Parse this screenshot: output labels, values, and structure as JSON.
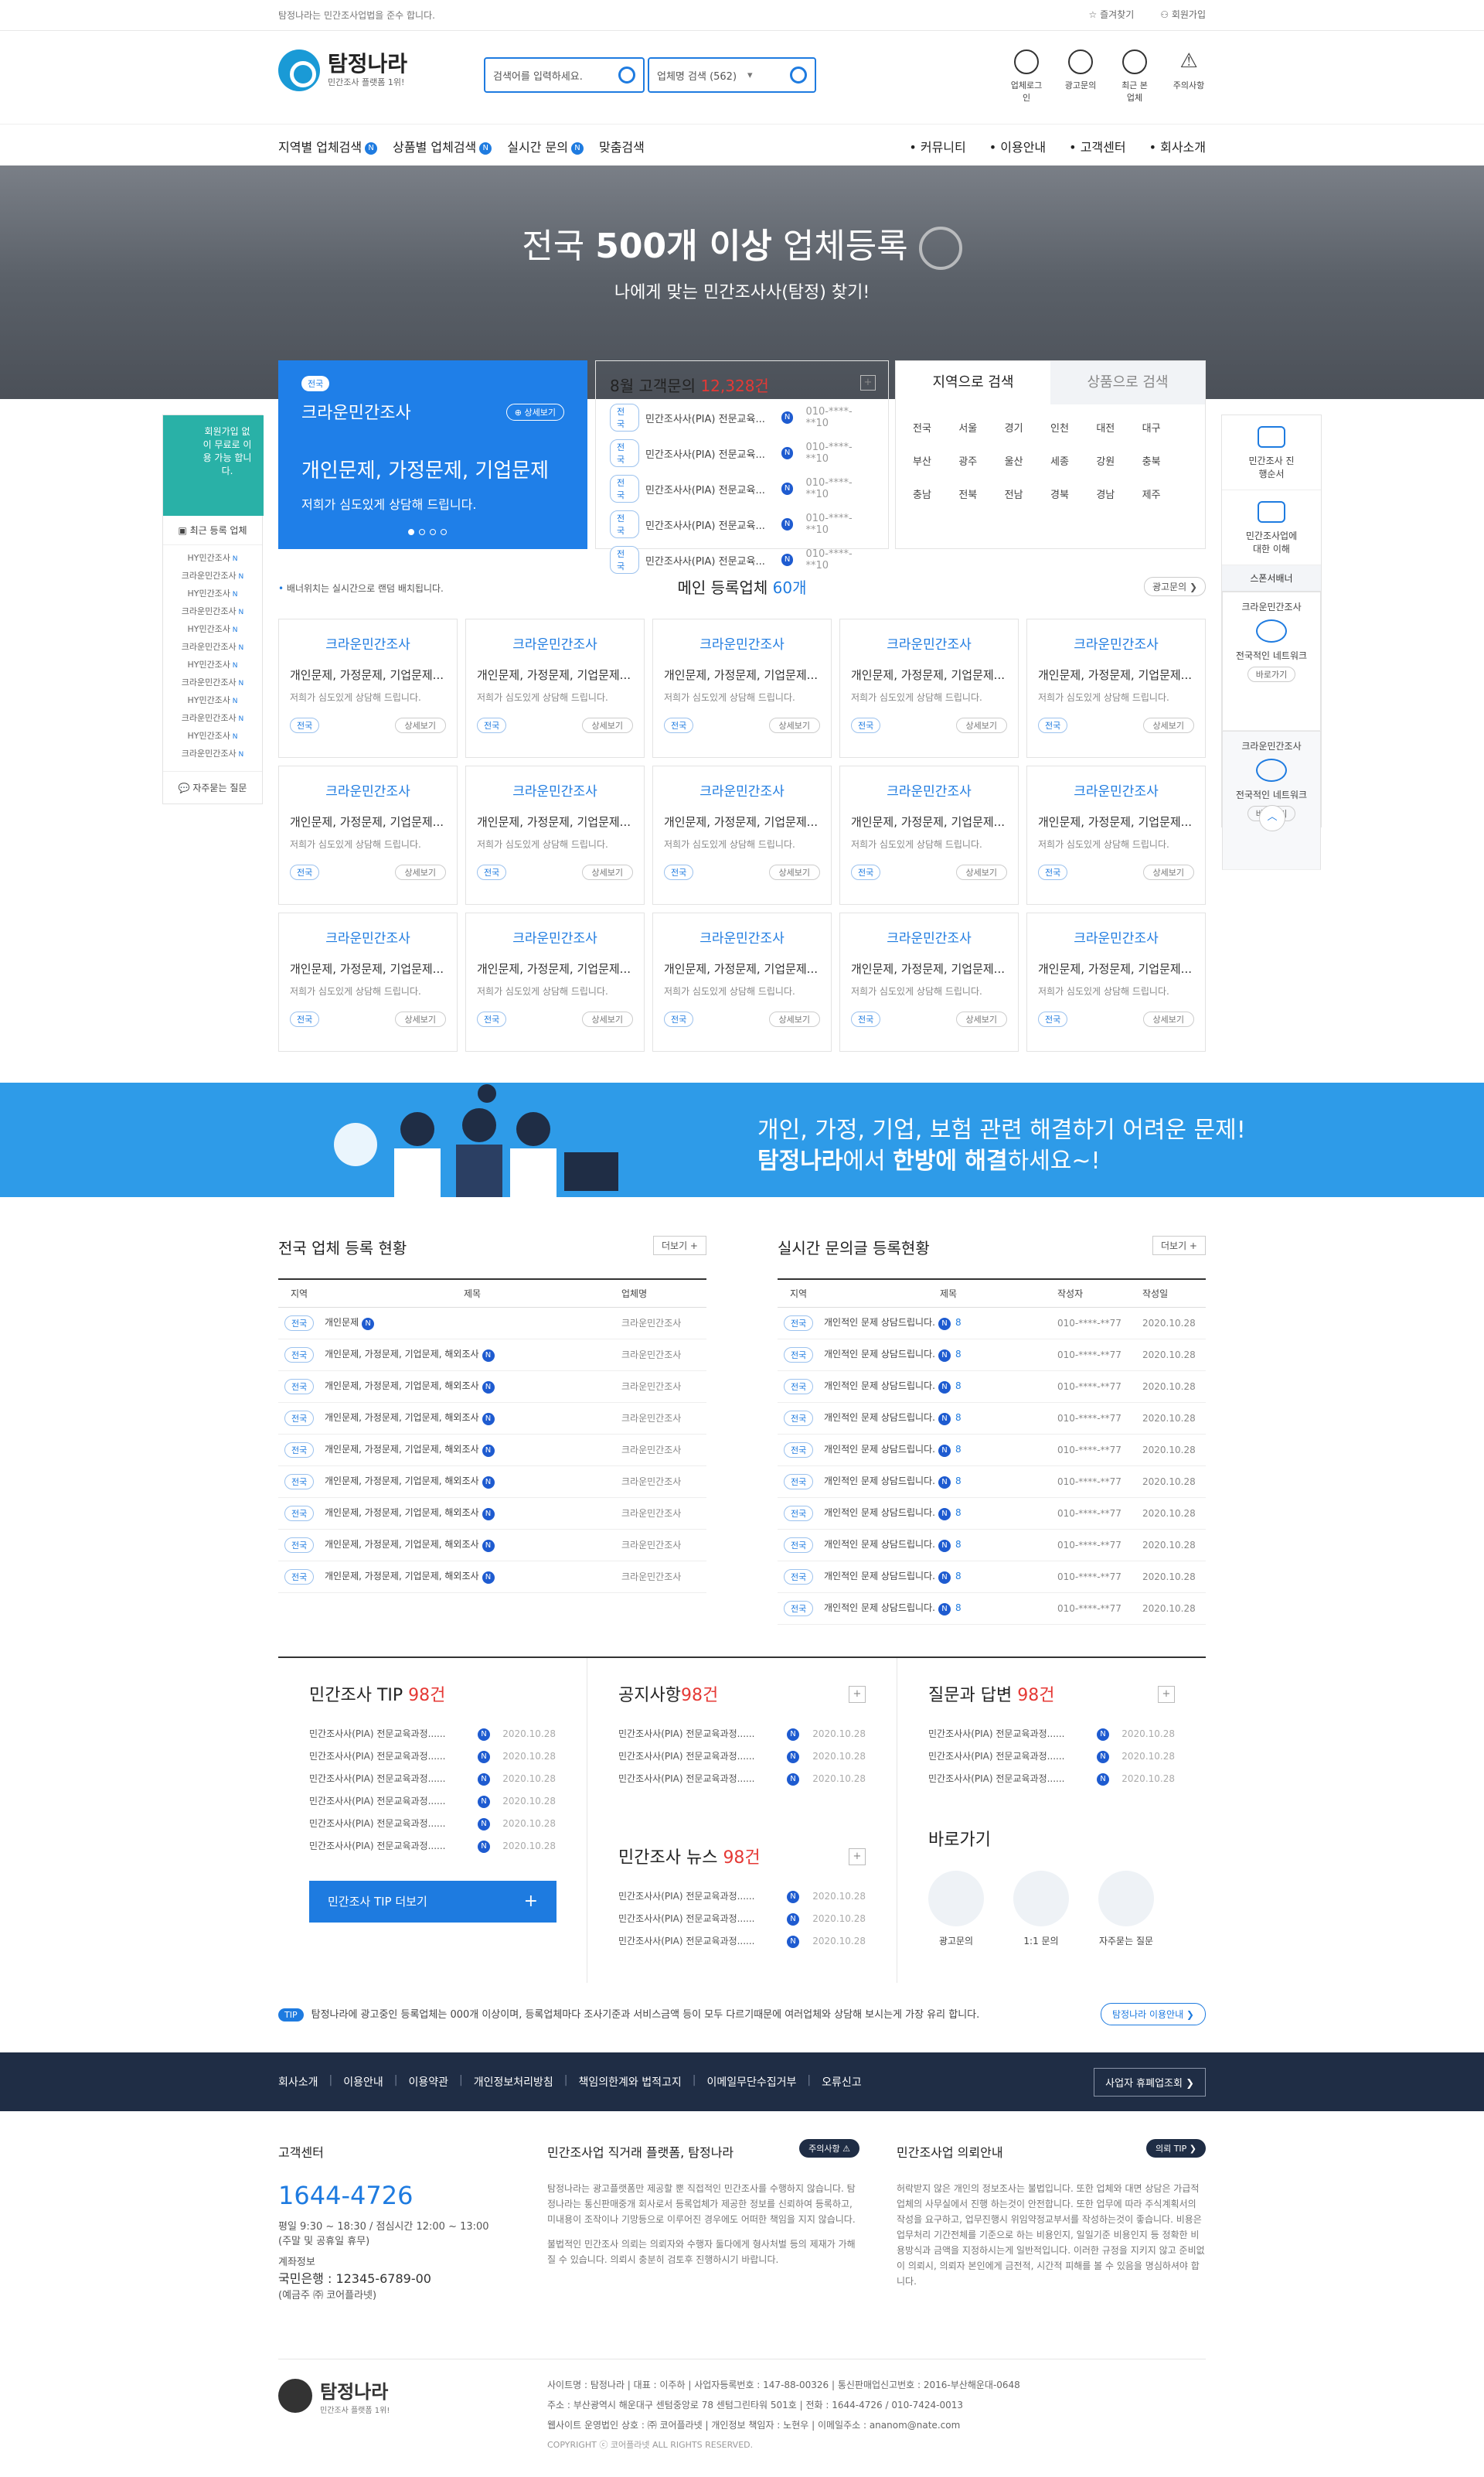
{
  "topbar": {
    "notice": "탐정나라는 민간조사업법을 준수 합니다.",
    "bookmark": "즐겨찾기",
    "join": "회원가입"
  },
  "header": {
    "logo": "탐정나라",
    "logo_sub": "민간조사 플랫폼 1위!",
    "search_placeholder": "검색어를 입력하세요.",
    "company_search": "업체명 검색 (562)",
    "icons": [
      {
        "label": "업체로그인",
        "icon": "user-icon"
      },
      {
        "label": "광고문의",
        "icon": "key-icon"
      },
      {
        "label": "최근 본 업체",
        "icon": "eye-icon"
      },
      {
        "label": "주의사항",
        "icon": "warning-icon"
      }
    ]
  },
  "nav": {
    "left": [
      "지역별 업체검색",
      "상품별 업체검색",
      "실시간 문의",
      "맞춤검색"
    ],
    "right": [
      "커뮤니티",
      "이용안내",
      "고객센터",
      "회사소개"
    ]
  },
  "hero": {
    "title_pre": "전국 ",
    "title_bold": "500개 이상",
    "title_post": " 업체등록",
    "subtitle": "나에게 맞는 민간조사사(탐정) 찾기!"
  },
  "promo": {
    "tag": "전국",
    "name": "크라운민간조사",
    "more": "상세보기",
    "headline": "개인문제, 가정문제, 기업문제",
    "sub": "저희가 심도있게 상담해 드립니다."
  },
  "inquiry": {
    "title": "8월 고객문의",
    "count": "12,328건",
    "plus": "+",
    "rows": [
      {
        "tag": "전국",
        "text": "민간조사사(PIA) 전문교육...",
        "phone": "010-****-**10"
      },
      {
        "tag": "전국",
        "text": "민간조사사(PIA) 전문교육...",
        "phone": "010-****-**10"
      },
      {
        "tag": "전국",
        "text": "민간조사사(PIA) 전문교육...",
        "phone": "010-****-**10"
      },
      {
        "tag": "전국",
        "text": "민간조사사(PIA) 전문교육...",
        "phone": "010-****-**10"
      },
      {
        "tag": "전국",
        "text": "민간조사사(PIA) 전문교육...",
        "phone": "010-****-**10"
      }
    ]
  },
  "area": {
    "tabs": [
      "지역으로 검색",
      "상품으로 검색"
    ],
    "regions": [
      "전국",
      "서울",
      "경기",
      "인천",
      "대전",
      "대구",
      "부산",
      "광주",
      "울산",
      "세종",
      "강원",
      "충북",
      "충남",
      "전북",
      "전남",
      "경북",
      "경남",
      "제주"
    ]
  },
  "left_side": {
    "banner": "회원가입 없이 무료로 이용 가능 합니다.",
    "header": "최근 등록 업체",
    "items": [
      "HY민간조사",
      "크라운민간조사",
      "HY민간조사",
      "크라운민간조사",
      "HY민간조사",
      "크라운민간조사",
      "HY민간조사",
      "크라운민간조사",
      "HY민간조사",
      "크라운민간조사",
      "HY민간조사",
      "크라운민간조사"
    ],
    "faq": "자주묻는 질문"
  },
  "right_side": {
    "blocks": [
      "민간조사 진행순서",
      "민간조사업에 대한 이해"
    ],
    "sponsor": "스폰서배너",
    "cards": [
      {
        "name": "크라운민간조사",
        "desc": "전국적인 네트워크",
        "go": "바로가기"
      },
      {
        "name": "크라운민간조사",
        "desc": "전국적인 네트워크",
        "go": "바로가기"
      }
    ]
  },
  "members": {
    "note": "배너위치는 실시간으로 랜덤 배치됩니다.",
    "title": "메인 등록업체",
    "count": "60개",
    "ad_btn": "광고문의",
    "card": {
      "name": "크라운민간조사",
      "desc": "개인문제, 가정문제, 기업문제...",
      "sub": "저희가 심도있게 상담해 드립니다.",
      "tag": "전국",
      "detail": "상세보기"
    }
  },
  "band": {
    "line1": "개인, 가정, 기업, 보험 관련 해결하기 어려운 문제!",
    "line2_pre": "탐정나라",
    "line2_mid": "에서 ",
    "line2_bold": "한방에 해결",
    "line2_post": "하세요~!"
  },
  "reg": {
    "title": "전국 업체 등록 현황",
    "more": "더보기 +",
    "cols": [
      "지역",
      "제목",
      "업체명"
    ],
    "rows": [
      [
        "전국",
        "개인문제",
        "크라운민간조사"
      ],
      [
        "전국",
        "개인문제, 가정문제, 기업문제, 해외조사",
        "크라운민간조사"
      ],
      [
        "전국",
        "개인문제, 가정문제, 기업문제, 해외조사",
        "크라운민간조사"
      ],
      [
        "전국",
        "개인문제, 가정문제, 기업문제, 해외조사",
        "크라운민간조사"
      ],
      [
        "전국",
        "개인문제, 가정문제, 기업문제, 해외조사",
        "크라운민간조사"
      ],
      [
        "전국",
        "개인문제, 가정문제, 기업문제, 해외조사",
        "크라운민간조사"
      ],
      [
        "전국",
        "개인문제, 가정문제, 기업문제, 해외조사",
        "크라운민간조사"
      ],
      [
        "전국",
        "개인문제, 가정문제, 기업문제, 해외조사",
        "크라운민간조사"
      ],
      [
        "전국",
        "개인문제, 가정문제, 기업문제, 해외조사",
        "크라운민간조사"
      ]
    ]
  },
  "live": {
    "title": "실시간 문의글 등록현황",
    "more": "더보기 +",
    "cols": [
      "지역",
      "제목",
      "작성자",
      "작성일"
    ],
    "rows": [
      [
        "전국",
        "개인적인 문제 상담드립니다.",
        "8",
        "010-****-**77",
        "2020.10.28"
      ],
      [
        "전국",
        "개인적인 문제 상담드립니다.",
        "8",
        "010-****-**77",
        "2020.10.28"
      ],
      [
        "전국",
        "개인적인 문제 상담드립니다.",
        "8",
        "010-****-**77",
        "2020.10.28"
      ],
      [
        "전국",
        "개인적인 문제 상담드립니다.",
        "8",
        "010-****-**77",
        "2020.10.28"
      ],
      [
        "전국",
        "개인적인 문제 상담드립니다.",
        "8",
        "010-****-**77",
        "2020.10.28"
      ],
      [
        "전국",
        "개인적인 문제 상담드립니다.",
        "8",
        "010-****-**77",
        "2020.10.28"
      ],
      [
        "전국",
        "개인적인 문제 상담드립니다.",
        "8",
        "010-****-**77",
        "2020.10.28"
      ],
      [
        "전국",
        "개인적인 문제 상담드립니다.",
        "8",
        "010-****-**77",
        "2020.10.28"
      ],
      [
        "전국",
        "개인적인 문제 상담드립니다.",
        "8",
        "010-****-**77",
        "2020.10.28"
      ],
      [
        "전국",
        "개인적인 문제 상담드립니다.",
        "8",
        "010-****-**77",
        "2020.10.28"
      ]
    ]
  },
  "boards": {
    "tip": {
      "title": "민간조사 TIP",
      "count": "98건",
      "items": [
        "민간조사사(PIA) 전문교육과정......",
        "민간조사사(PIA) 전문교육과정......",
        "민간조사사(PIA) 전문교육과정......",
        "민간조사사(PIA) 전문교육과정......",
        "민간조사사(PIA) 전문교육과정......",
        "민간조사사(PIA) 전문교육과정......"
      ],
      "date": "2020.10.28",
      "button": "민간조사 TIP 더보기"
    },
    "notice": {
      "title": "공지사항",
      "count": "98건",
      "items": [
        "민간조사사(PIA) 전문교육과정......",
        "민간조사사(PIA) 전문교육과정......",
        "민간조사사(PIA) 전문교육과정......"
      ],
      "date": "2020.10.28"
    },
    "news": {
      "title": "민간조사 뉴스",
      "count": "98건",
      "items": [
        "민간조사사(PIA) 전문교육과정......",
        "민간조사사(PIA) 전문교육과정......",
        "민간조사사(PIA) 전문교육과정......"
      ],
      "date": "2020.10.28"
    },
    "qna": {
      "title": "질문과 답변",
      "count": "98건",
      "items": [
        "민간조사사(PIA) 전문교육과정......",
        "민간조사사(PIA) 전문교육과정......",
        "민간조사사(PIA) 전문교육과정......"
      ],
      "date": "2020.10.28"
    },
    "quick": {
      "title": "바로가기",
      "items": [
        "광고문의",
        "1:1 문의",
        "자주묻는 질문"
      ]
    }
  },
  "tipline": {
    "tag": "TIP",
    "text": "탐정나라에 광고중인 등록업체는 000개 이상이며, 등록업체마다 조사기준과 서비스금액 등이 모두 다르기때문에 여러업체와 상담해 보시는게 가장 유리 합니다.",
    "button": "탐정나라 이용안내 ❯"
  },
  "footer": {
    "links": [
      "회사소개",
      "이용안내",
      "이용약관",
      "개인정보처리방침",
      "책임의한계와 법적고지",
      "이메일무단수집거부",
      "오류신고"
    ],
    "biz_btn": "사업자 휴폐업조회 ❯",
    "cs_title": "고객센터",
    "phone": "1644-4726",
    "hours": "평일 9:30 ~ 18:30 / 점심시간 12:00 ~ 13:00",
    "holiday": "(주말 및 공휴일 휴무)",
    "acct_title": "계좌정보",
    "acct": "국민은행 : 12345-6789-00",
    "acct_owner": "(예금주 ㈜ 코어플라넷)",
    "platform_title": "민간조사업 직거래 플랫폼, 탐정나라",
    "platform_pill": "주의사항 ⚠",
    "platform_text": "탐정나라는 광고플랫폼만 제공할 뿐 직접적인 민간조사를 수행하지 않습니다. 탐정나라는 통신판매중개 회사로서 등록업체가 제공한 정보를 신뢰하여 등록하고, 미내용이 조작이나 기망등으로 이루어진 경우에도 어떠한 책임을 지지 않습니다.",
    "platform_text2": "불법적인 민간조사 의뢰는 의뢰자와 수행자 둘다에게 형사처벌 등의 제재가 가해질 수 있습니다. 의뢰시 충분히 검토후 진행하시기 바랍니다.",
    "req_title": "민간조사업 의뢰안내",
    "req_pill": "의뢰 TIP ❯",
    "req_text": "허락받지 않은 개인의 정보조사는 불법입니다. 또한 업체와 대면 상담은 가급적 업체의 사무실에서 진행 하는것이 안전합니다. 또한 업무에 따라 주식계획서의 작성을 요구하고, 업무진행시 위임약정교부서를 작성하는것이 좋습니다. 비용은 업무처리 기간전체를 기준으로 하는 비용인지, 일일기준 비용인지 등 정확한 비용방식과 금액을 지정하시는게 일반적입니다. 이러한 규정을 지키지 않고 준비없이 의뢰시, 의뢰자 본인에게 금전적, 시간적 피해를 볼 수 있음을 명심하셔야 합니다.",
    "logo": "탐정나라",
    "logo_sub": "민간조사 플랫폼 1위!",
    "info1": "사이트명 : 탐정나라  |  대표 : 이주하  |  사업자등록번호 : 147-88-00326  |  통신판매업신고번호 : 2016-부산해운대-0648",
    "info2": "주소 : 부산광역시 해운대구 센텀중앙로 78 센텀그린타워 501호  |  전화 : 1644-4726 / 010-7424-0013",
    "info3": "웹사이트 운영법인 상호 : ㈜ 코어플라넷  |  개인정보 책임자 : 노현우  |  이메일주소 : ananom@nate.com",
    "copy": "COPYRIGHT ⓒ 코어플라넷 ALL RIGHTS RESERVED."
  }
}
